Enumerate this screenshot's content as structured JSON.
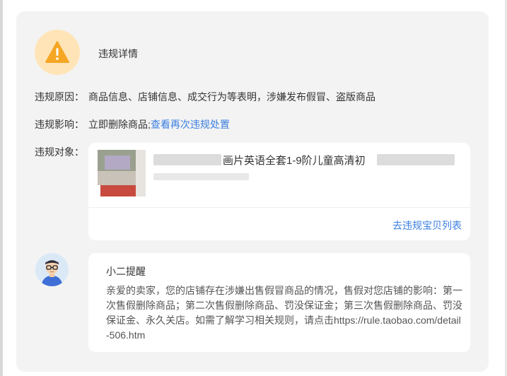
{
  "title": "违规详情",
  "rows": {
    "reason_label": "违规原因：",
    "reason_text": "商品信息、店铺信息、成交行为等表明，涉嫌发布假冒、盗版商品",
    "impact_label": "违规影响：",
    "impact_text": "立即删除商品;",
    "impact_link": "查看再次违规处置",
    "object_label": "违规对象："
  },
  "product": {
    "title_visible": "画片英语全套1-9阶儿童高清初",
    "link": "去违规宝贝列表"
  },
  "reminder": {
    "title": "小二提醒",
    "body": "亲爱的卖家，您的店铺存在涉嫌出售假冒商品的情况，售假对您店铺的影响：第一次售假删除商品；第二次售假删除商品、罚没保证金；第三次售假删除商品、罚没保证金、永久关店。如需了解学习相关规则，请点击https://rule.taobao.com/detail-506.htm"
  },
  "icons": {
    "warning": "warning-triangle-icon",
    "avatar": "support-agent-avatar"
  },
  "colors": {
    "warning_bg": "#ffe4b8",
    "warning_fg": "#f5a623",
    "link": "#3b7fe0"
  }
}
